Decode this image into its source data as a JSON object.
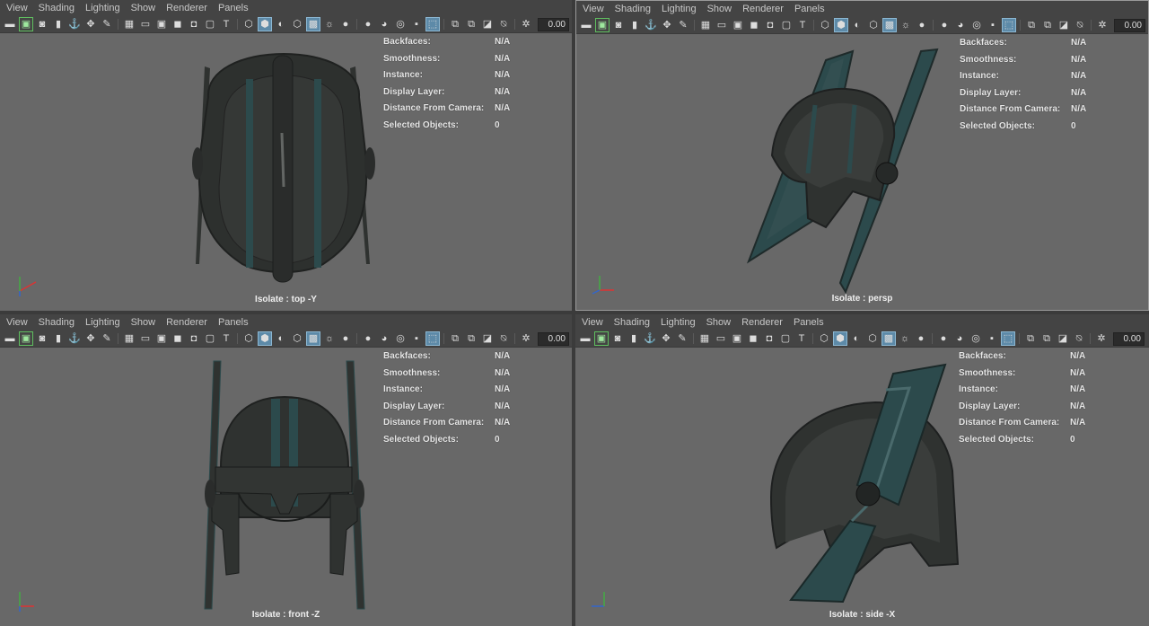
{
  "menu": [
    "View",
    "Shading",
    "Lighting",
    "Show",
    "Renderer",
    "Panels"
  ],
  "toolbar_value": "0.00",
  "hud": [
    {
      "key": "Backfaces:",
      "value": "N/A"
    },
    {
      "key": "Smoothness:",
      "value": "N/A"
    },
    {
      "key": "Instance:",
      "value": "N/A"
    },
    {
      "key": "Display Layer:",
      "value": "N/A"
    },
    {
      "key": "Distance From Camera:",
      "value": "N/A"
    },
    {
      "key": "Selected Objects:",
      "value": "0"
    }
  ],
  "viewports": {
    "top": {
      "label": "Isolate : top -Y"
    },
    "persp": {
      "label": "Isolate : persp"
    },
    "front": {
      "label": "Isolate : front -Z"
    },
    "side": {
      "label": "Isolate : side -X"
    }
  },
  "colors": {
    "viewport_bg": "#686868",
    "menubar_bg": "#444444",
    "helmet_dark": "#2f3230",
    "helmet_accent": "#2c4a4c"
  }
}
